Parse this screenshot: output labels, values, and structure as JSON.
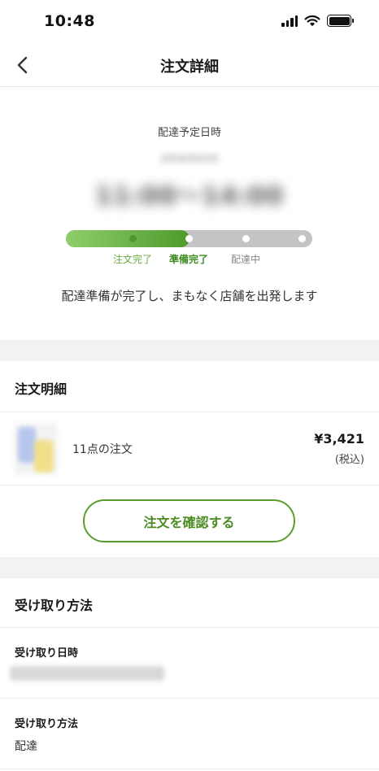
{
  "status_bar": {
    "time": "10:48"
  },
  "nav": {
    "title": "注文詳細"
  },
  "delivery": {
    "label": "配達予定日時",
    "date": "2024/XX/XX",
    "time_range": "11:00〜14:00",
    "progress_fraction": 0.5,
    "steps": [
      {
        "label": "注文完了",
        "state": "completed"
      },
      {
        "label": "準備完了",
        "state": "current"
      },
      {
        "label": "配達中",
        "state": "pending"
      }
    ],
    "message": "配達準備が完了し、まもなく店舗を出発します"
  },
  "order_detail": {
    "header": "注文明細",
    "item_title": "11点の注文",
    "price": "¥3,421",
    "tax_note": "(税込)",
    "confirm_button": "注文を確認する"
  },
  "receive": {
    "header": "受け取り方法",
    "date_label": "受け取り日時",
    "method_label": "受け取り方法",
    "method_value": "配達"
  },
  "colors": {
    "accent": "#5a9e2e",
    "progress_start": "#8fce6a",
    "progress_end": "#4e9a2c",
    "track": "#c4c4c4",
    "band": "#f2f2f2"
  }
}
